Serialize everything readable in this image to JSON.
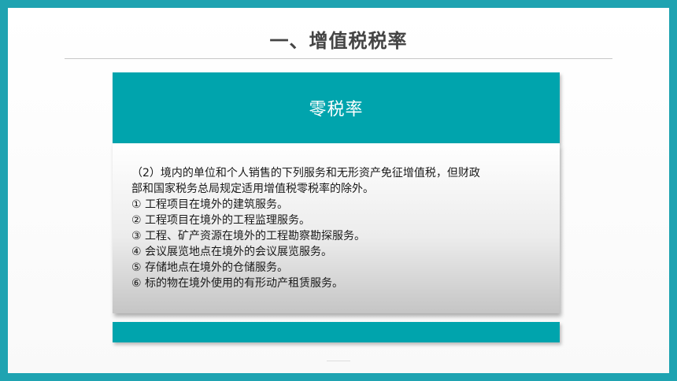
{
  "slide": {
    "title": "一、增值税税率",
    "card": {
      "heading": "零税率",
      "lines": [
        "（2）境内的单位和个人销售的下列服务和无形资产免征增值税，但财政",
        "部和国家税务总局规定适用增值税零税率的除外。",
        "① 工程项目在境外的建筑服务。",
        "② 工程项目在境外的工程监理服务。",
        "③ 工程、矿产资源在境外的工程勘察勘探服务。",
        "④ 会议展览地点在境外的会议展览服务。",
        "⑤ 存储地点在境外的仓储服务。",
        "⑥ 标的物在境外使用的有形动产租赁服务。"
      ]
    }
  },
  "colors": {
    "frame": "#1fa3b1",
    "accent": "#00a4ad",
    "title_text": "#444444"
  }
}
